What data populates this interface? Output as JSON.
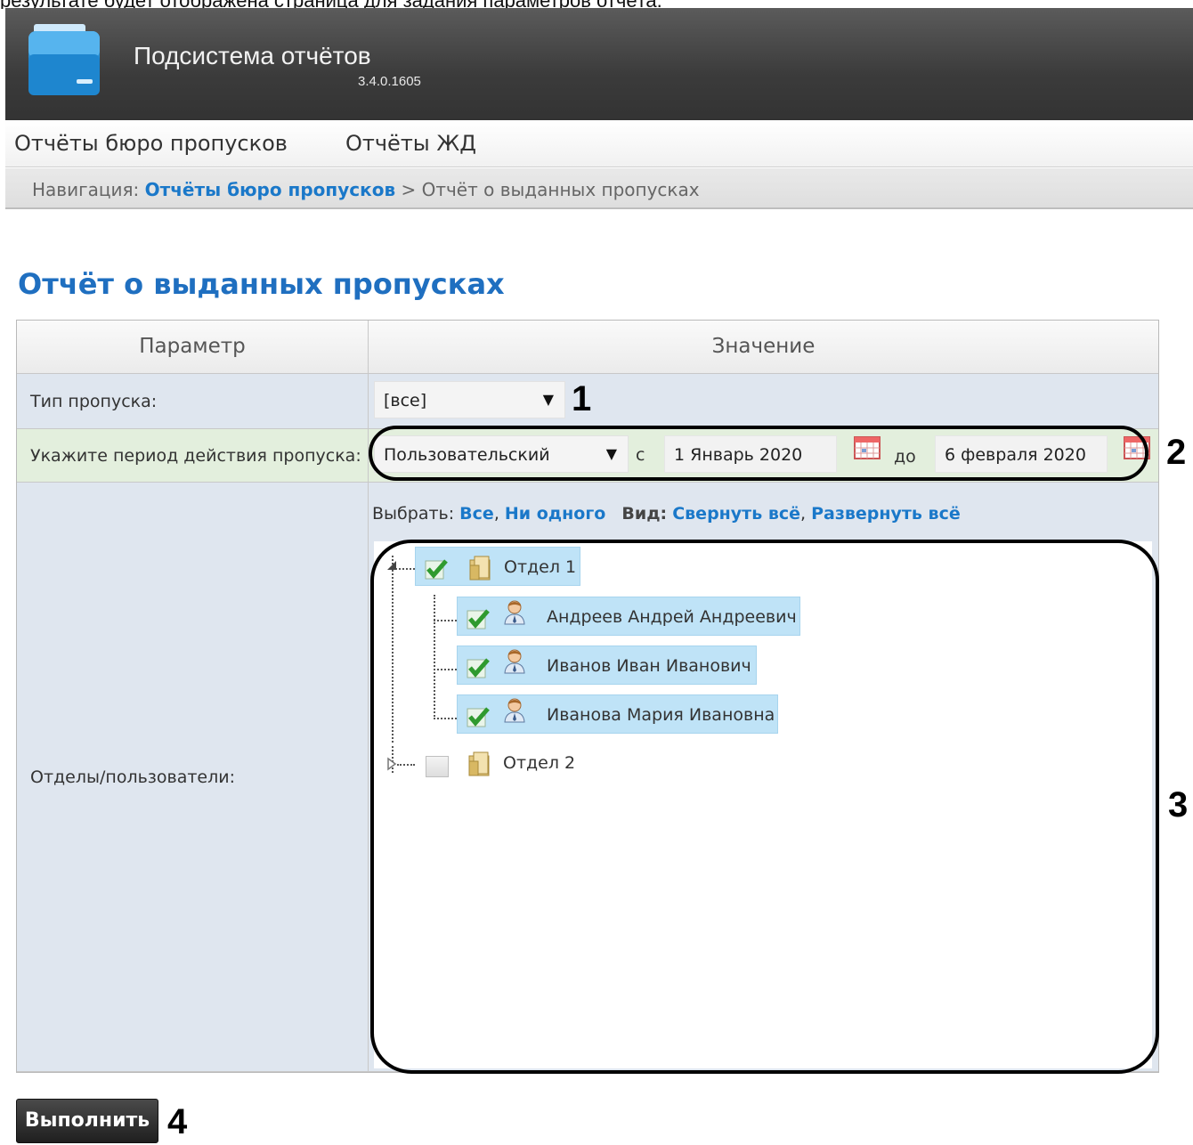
{
  "caption": "результате будет отображена страница для задания параметров отчёта.",
  "app": {
    "title": "Подсистема отчётов",
    "version": "3.4.0.1605",
    "logo_icon": "folder-logo"
  },
  "menu": {
    "items": [
      "Отчёты бюро пропусков",
      "Отчёты ЖД"
    ]
  },
  "breadcrumb": {
    "label": "Навигация:",
    "link": "Отчёты бюро пропусков",
    "separator": ">",
    "current": "Отчёт о выданных пропусках"
  },
  "page": {
    "title": "Отчёт о выданных пропусках"
  },
  "table": {
    "headers": {
      "param": "Параметр",
      "value": "Значение"
    },
    "pass_type": {
      "label": "Тип пропуска:",
      "value": "[все]"
    },
    "period": {
      "label": "Укажите период действия пропуска:",
      "mode": "Пользовательский",
      "from_label": "с",
      "from": "1 Январь 2020",
      "to_label": "до",
      "to": "6 февраля 2020"
    },
    "departments": {
      "label": "Отделы/пользователи:",
      "select_label": "Выбрать:",
      "select_all": "Все",
      "select_none": "Ни одного",
      "view_label": "Вид:",
      "collapse_all": "Свернуть всё",
      "expand_all": "Развернуть всё",
      "tree": [
        {
          "name": "Отдел 1",
          "checked": true,
          "expanded": true,
          "children": [
            {
              "name": "Андреев Андрей Андреевич",
              "checked": true
            },
            {
              "name": "Иванов Иван Иванович",
              "checked": true
            },
            {
              "name": "Иванова Мария Ивановна",
              "checked": true
            }
          ]
        },
        {
          "name": "Отдел 2",
          "checked": false,
          "expanded": false
        }
      ]
    }
  },
  "actions": {
    "run": "Выполнить"
  },
  "callouts": [
    "1",
    "2",
    "3",
    "4"
  ],
  "colors": {
    "link": "#1a78c9",
    "title": "#1f6fc0",
    "selected_node": "#bfe3f7",
    "row_blue": "#dfe6ef",
    "row_green": "#e3efdd"
  }
}
